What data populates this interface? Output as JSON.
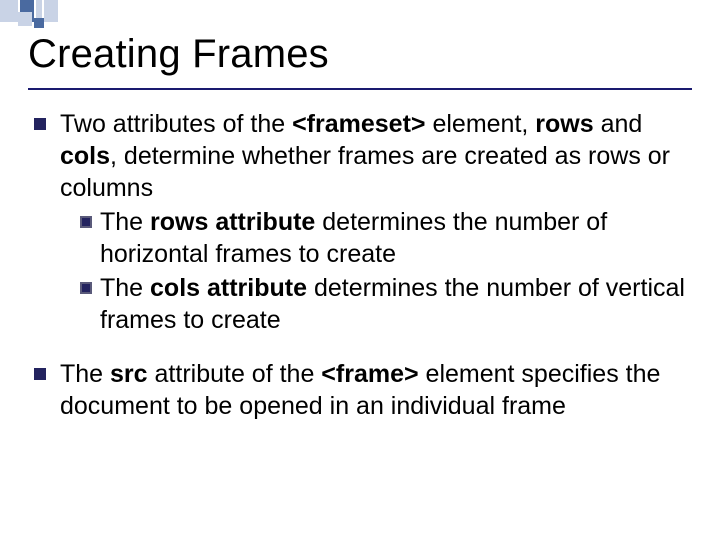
{
  "title": "Creating Frames",
  "bullets": [
    {
      "lead_1": "Two attributes of the ",
      "tag_1": "<frameset>",
      "mid_1a": " element, ",
      "kw_rows": "rows",
      "mid_1b": " and ",
      "kw_cols": "cols",
      "tail_1": ", determine whether frames are created as rows or columns",
      "sub": [
        {
          "lead": "The ",
          "kw": "rows attribute",
          "tail": " determines the number of horizontal frames to create"
        },
        {
          "lead": "The ",
          "kw": "cols attribute",
          "tail": " determines the number of vertical frames to create"
        }
      ]
    },
    {
      "lead_2a": "The ",
      "kw_src": "src",
      "mid_2a": " attribute of the ",
      "tag_2": "<frame>",
      "tail_2": " element specifies the document to be opened in an individual frame"
    }
  ],
  "deco": {
    "accent": "#4a6aa0",
    "light": "#c9d3e6"
  }
}
